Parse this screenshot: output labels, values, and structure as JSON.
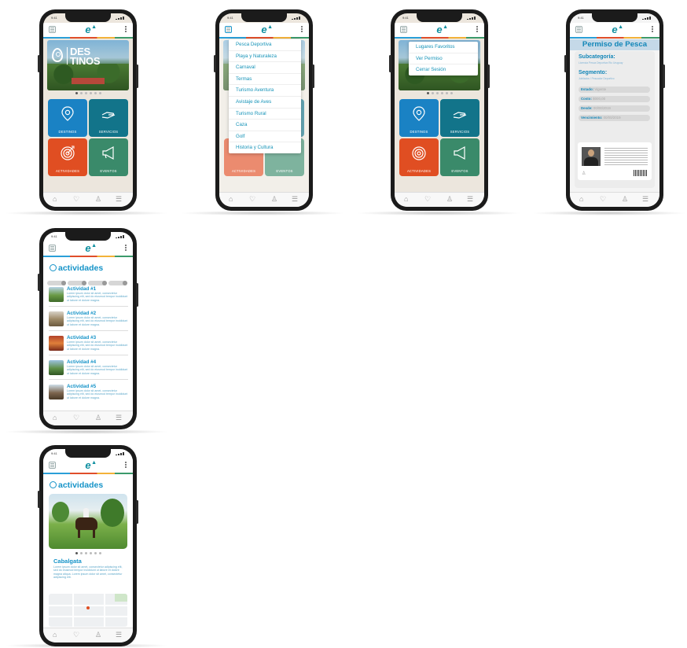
{
  "status": {
    "time": "9:41"
  },
  "nav_icons": [
    "home-icon",
    "heart-icon",
    "user-icon",
    "settings-icon"
  ],
  "colors": {
    "brand": "#0E8FA0",
    "blue_tile": "#1A82C4",
    "teal_tile": "#12748A",
    "orange_tile": "#E04E22",
    "green_tile": "#3A8A6A",
    "title_blue": "#1593C8"
  },
  "home": {
    "hero_line1": "DES",
    "hero_line2": "TINOS",
    "tiles": [
      {
        "label": "DESTINOS",
        "icon": "location-pin-icon"
      },
      {
        "label": "SERVICIOS",
        "icon": "hand-icon"
      },
      {
        "label": "ACTIVIDADES",
        "icon": "target-icon"
      },
      {
        "label": "EVENTOS",
        "icon": "megaphone-icon"
      }
    ]
  },
  "categories_menu": [
    "Pesca Deportiva",
    "Playa y Naturaleza",
    "Carnaval",
    "Termas",
    "Turismo Aventura",
    "Avistaje de Aves",
    "Turismo Rural",
    "Caza",
    "Golf",
    "Historia y Cultura"
  ],
  "options_menu": [
    "Lugares Favoritos",
    "Ver Permiso",
    "Cerrar Sesión"
  ],
  "permit": {
    "title": "Permiso de Pesca",
    "subcategory_label": "Subcategoría:",
    "subcategory_text": "Licencia Pesca Deportiva Rio Uruguay",
    "segment_label": "Segmento:",
    "segment_text": "Jubilados / Pescador Deportivo",
    "fields": [
      {
        "label": "Estado:",
        "value": "Vigente"
      },
      {
        "label": "Costo:",
        "value": "$000,00"
      },
      {
        "label": "Desde:",
        "value": "00/00/2019"
      },
      {
        "label": "Vencimiento:",
        "value": "00/00/2019"
      }
    ]
  },
  "activities": {
    "title": "actividades",
    "items": [
      {
        "title": "Actividad #1",
        "desc": "Lorem ipsum dolor sit amet, consectetur adipiscing elit, sed do eiusmod tempor incididunt ut labore et dolore magna."
      },
      {
        "title": "Actividad #2",
        "desc": "Lorem ipsum dolor sit amet, consectetur adipiscing elit, sed do eiusmod tempor incididunt ut labore et dolore magna."
      },
      {
        "title": "Actividad #3",
        "desc": "Lorem ipsum dolor sit amet, consectetur adipiscing elit, sed do eiusmod tempor incididunt ut labore et dolore magna."
      },
      {
        "title": "Actividad #4",
        "desc": "Lorem ipsum dolor sit amet, consectetur adipiscing elit, sed do eiusmod tempor incididunt ut labore et dolore magna."
      },
      {
        "title": "Actividad #5",
        "desc": "Lorem ipsum dolor sit amet, consectetur adipiscing elit, sed do eiusmod tempor incididunt ut labore et dolore magna."
      }
    ]
  },
  "detail": {
    "title": "actividades",
    "activity_name": "Cabalgata",
    "desc": "Lorem ipsum dolor sit amet, consectetur adipiscing elit, sed do eiusmod tempor incididunt ut labore et dolore magna aliqua. Lorem ipsum dolor sit amet, consectetur adipiscing elit."
  }
}
